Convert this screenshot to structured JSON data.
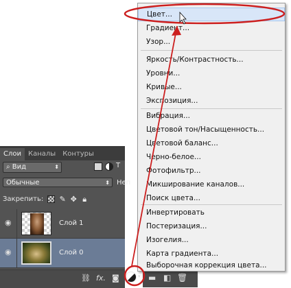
{
  "layers_panel": {
    "tabs": [
      {
        "label": "Слои",
        "active": true
      },
      {
        "label": "Каналы",
        "active": false
      },
      {
        "label": "Контуры",
        "active": false
      }
    ],
    "filter_label": "Вид",
    "blend_mode": "Обычные",
    "opacity_label_partial": "Неп",
    "lock_label": "Закрепить:",
    "layers": [
      {
        "name": "Слой 1",
        "selected": false
      },
      {
        "name": "Слой 0",
        "selected": true
      }
    ],
    "bottom_fx": "fx."
  },
  "adjustment_menu": {
    "items": [
      {
        "label": "Цвет...",
        "highlighted": true
      },
      {
        "label": "Градиент..."
      },
      {
        "label": "Узор..."
      },
      {
        "label": "Яркость/Контрастность..."
      },
      {
        "label": "Уровни..."
      },
      {
        "label": "Кривые..."
      },
      {
        "label": "Экспозиция..."
      },
      {
        "label": "Вибрация..."
      },
      {
        "label": "Цветовой тон/Насыщенность..."
      },
      {
        "label": "Цветовой баланс..."
      },
      {
        "label": "Черно-белое..."
      },
      {
        "label": "Фотофильтр..."
      },
      {
        "label": "Микширование каналов..."
      },
      {
        "label": "Поиск цвета..."
      },
      {
        "label": "Инвертировать"
      },
      {
        "label": "Постеризация..."
      },
      {
        "label": "Изогелия..."
      },
      {
        "label": "Карта градиента..."
      },
      {
        "label": "Выборочная коррекция цвета..."
      }
    ]
  },
  "annotation": {
    "color": "#cc1f1f"
  },
  "colors": {
    "panel_bg": "#535353",
    "selected_layer": "#6b7c96",
    "menu_bg": "#f0f0f0",
    "menu_highlight": "#d8e6f8"
  }
}
